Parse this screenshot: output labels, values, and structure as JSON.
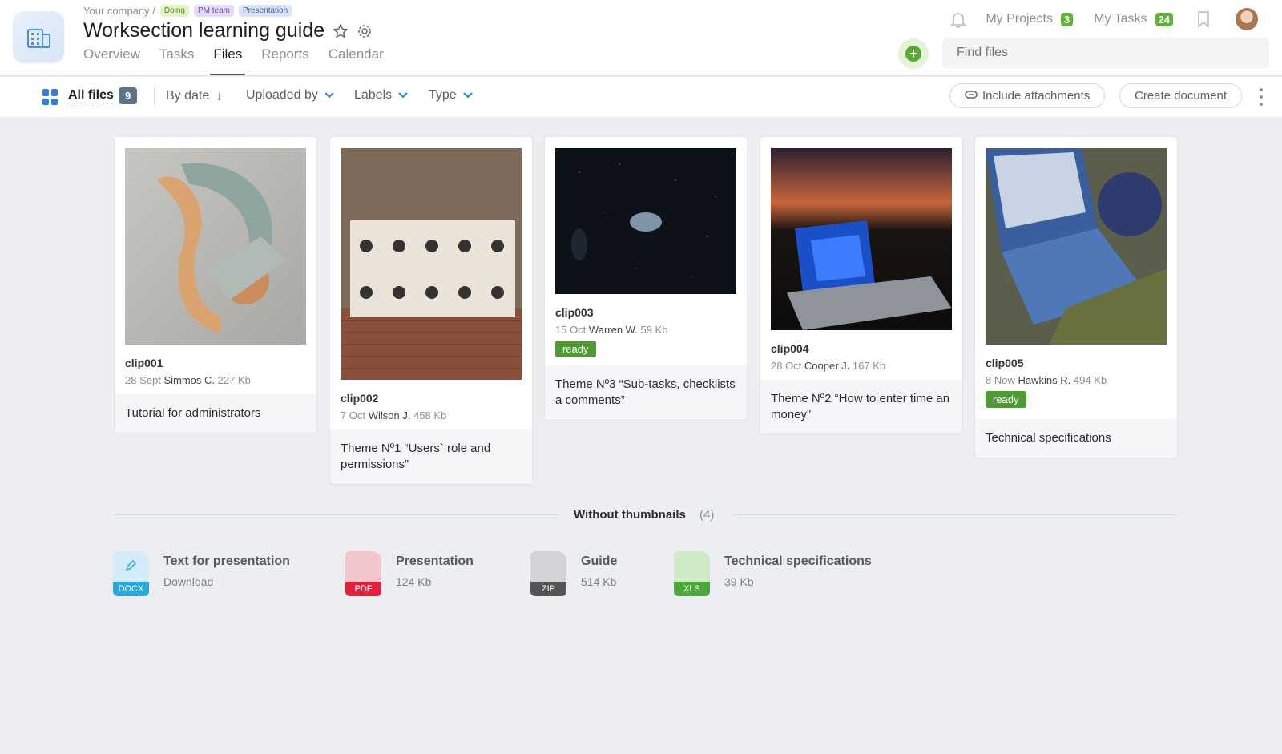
{
  "header": {
    "breadcrumb": "Your company /",
    "tags": [
      "Doing",
      "PM team",
      "Presentation"
    ],
    "title": "Worksection learning guide",
    "tabs": [
      "Overview",
      "Tasks",
      "Files",
      "Reports",
      "Calendar"
    ],
    "active_tab": "Files",
    "my_projects_label": "My Projects",
    "my_projects_count": "3",
    "my_tasks_label": "My Tasks",
    "my_tasks_count": "24",
    "search_placeholder": "Find files",
    "accent_color": "#54ab2c"
  },
  "toolbar": {
    "all_files_label": "All files",
    "all_files_count": "9",
    "by_date": "By date",
    "uploaded_by": "Uploaded by",
    "labels": "Labels",
    "type": "Type",
    "include_attachments": "Include attachments",
    "create_document": "Create document"
  },
  "cards": [
    {
      "name": "clip001",
      "date": "28 Sept",
      "author": "Simmos C.",
      "size": "227 Kb",
      "caption": "Tutorial for administrators"
    },
    {
      "name": "clip002",
      "date": "7 Oct",
      "author": "Wilson J.",
      "size": "458 Kb",
      "caption": "Theme Nº1 “Users` role and permissions”"
    },
    {
      "name": "clip003",
      "date": "15 Oct",
      "author": "Warren W.",
      "size": "59 Kb",
      "status": "ready",
      "caption": "Theme Nº3 “Sub-tasks, checklists a comments”"
    },
    {
      "name": "clip004",
      "date": "28 Oct",
      "author": "Cooper J.",
      "size": "167 Kb",
      "caption": "Theme Nº2 “How to enter time an money”"
    },
    {
      "name": "clip005",
      "date": "8 Now",
      "author": "Hawkins R.",
      "size": "494 Kb",
      "status": "ready",
      "caption": "Technical specifications"
    }
  ],
  "without_thumbnails": {
    "title": "Without thumbnails",
    "count": "(4)",
    "files": [
      {
        "ext": "DOCX",
        "name": "Text for presentation",
        "sub": "Download",
        "color": "#29a8e0",
        "bg": "#d4ecf9"
      },
      {
        "ext": "PDF",
        "name": "Presentation",
        "sub": "124 Kb",
        "color": "#e5203f",
        "bg": "#f3c6ce"
      },
      {
        "ext": "ZIP",
        "name": "Guide",
        "sub": "514 Kb",
        "color": "#555",
        "bg": "#d1d3d6"
      },
      {
        "ext": "XLS",
        "name": "Technical specifications",
        "sub": "39 Kb",
        "color": "#4aa83a",
        "bg": "#cfe9c6"
      }
    ]
  }
}
